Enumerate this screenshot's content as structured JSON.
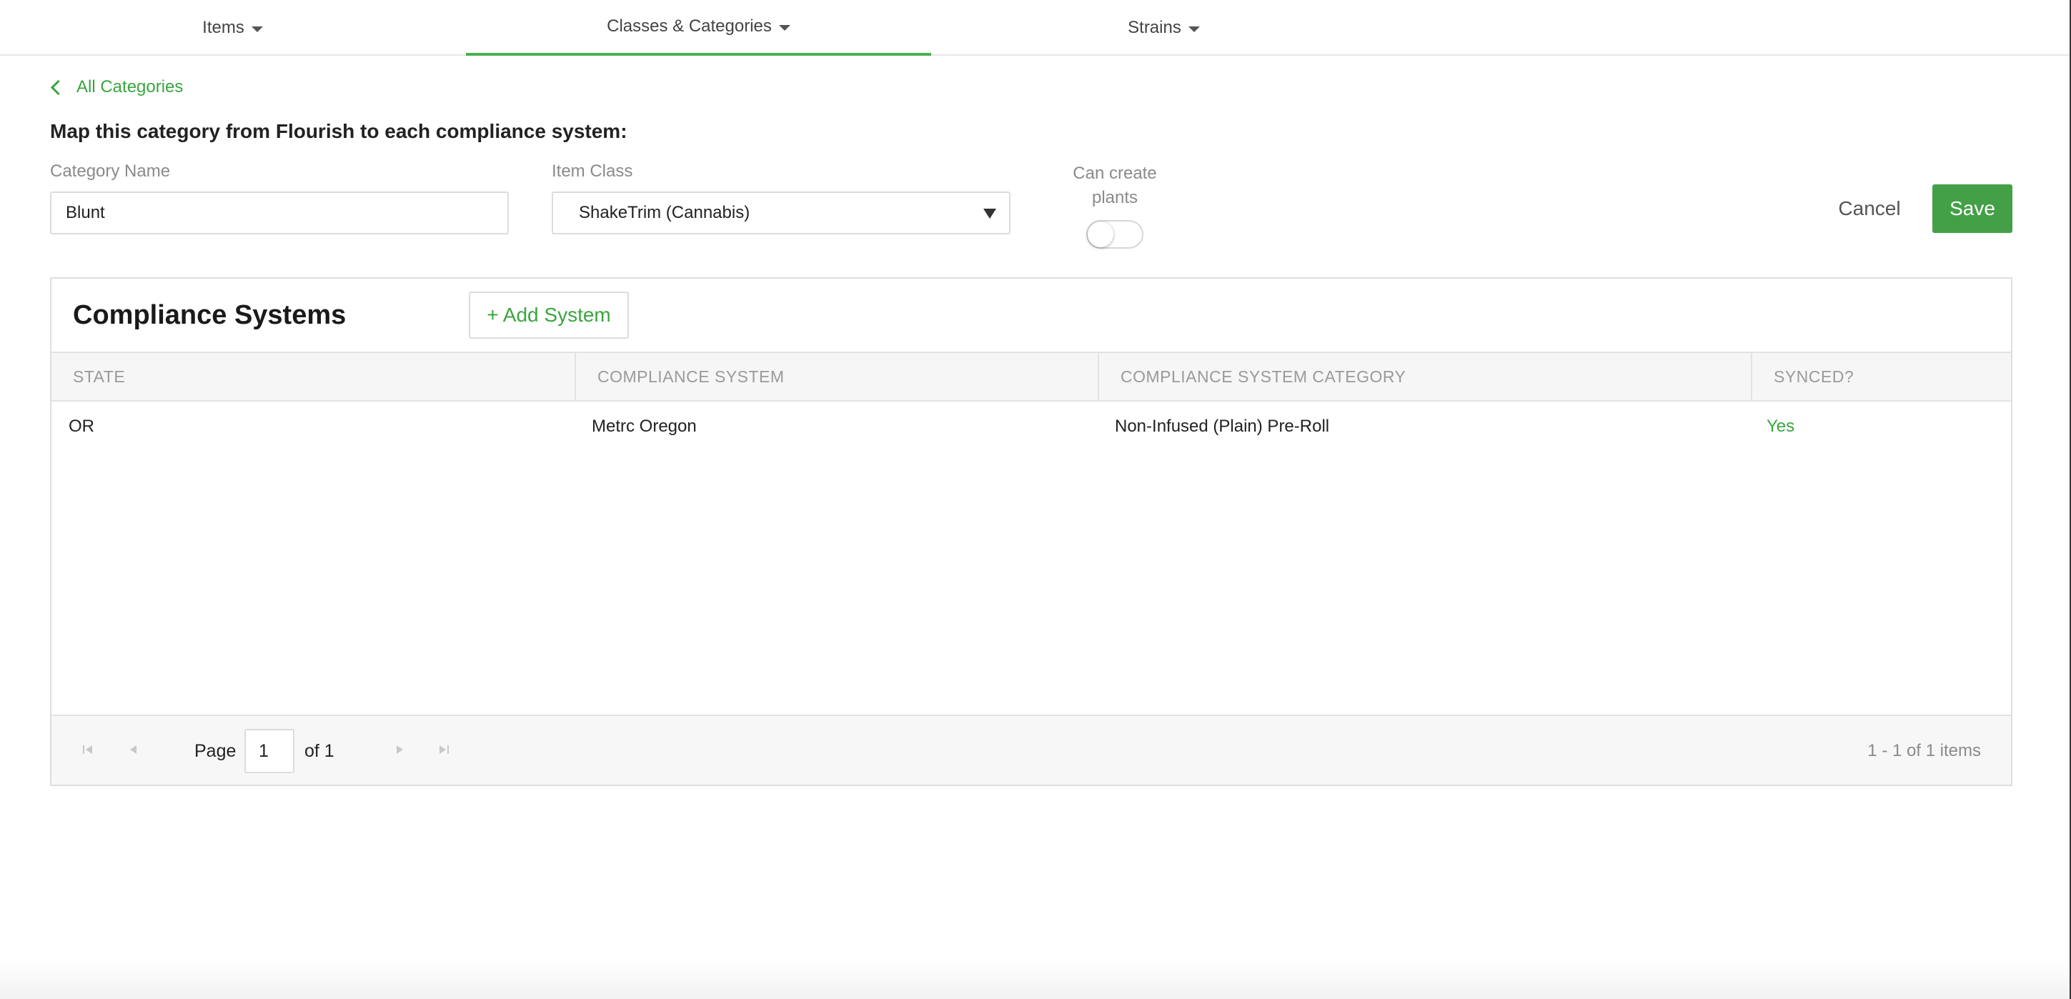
{
  "nav": {
    "tabs": [
      {
        "label": "Items",
        "active": false
      },
      {
        "label": "Classes & Categories",
        "active": true
      },
      {
        "label": "Strains",
        "active": false
      }
    ]
  },
  "back_link": "All Categories",
  "heading": "Map this category from Flourish to each compliance system:",
  "form": {
    "category_name_label": "Category Name",
    "category_name_value": "Blunt",
    "item_class_label": "Item Class",
    "item_class_value": "ShakeTrim (Cannabis)",
    "can_create_label_line1": "Can create",
    "can_create_label_line2": "plants",
    "can_create_plants": false
  },
  "actions": {
    "cancel": "Cancel",
    "save": "Save"
  },
  "compliance": {
    "title": "Compliance Systems",
    "add_button": "+ Add System",
    "columns": [
      "STATE",
      "COMPLIANCE SYSTEM",
      "COMPLIANCE SYSTEM CATEGORY",
      "SYNCED?"
    ],
    "rows": [
      {
        "state": "OR",
        "system": "Metrc Oregon",
        "category": "Non-Infused (Plain) Pre-Roll",
        "synced": "Yes"
      }
    ]
  },
  "pager": {
    "page_label": "Page",
    "page_value": "1",
    "of_label": "of 1",
    "summary": "1 - 1 of 1 items"
  },
  "colors": {
    "accent": "#43a047",
    "link": "#3aa53f"
  }
}
